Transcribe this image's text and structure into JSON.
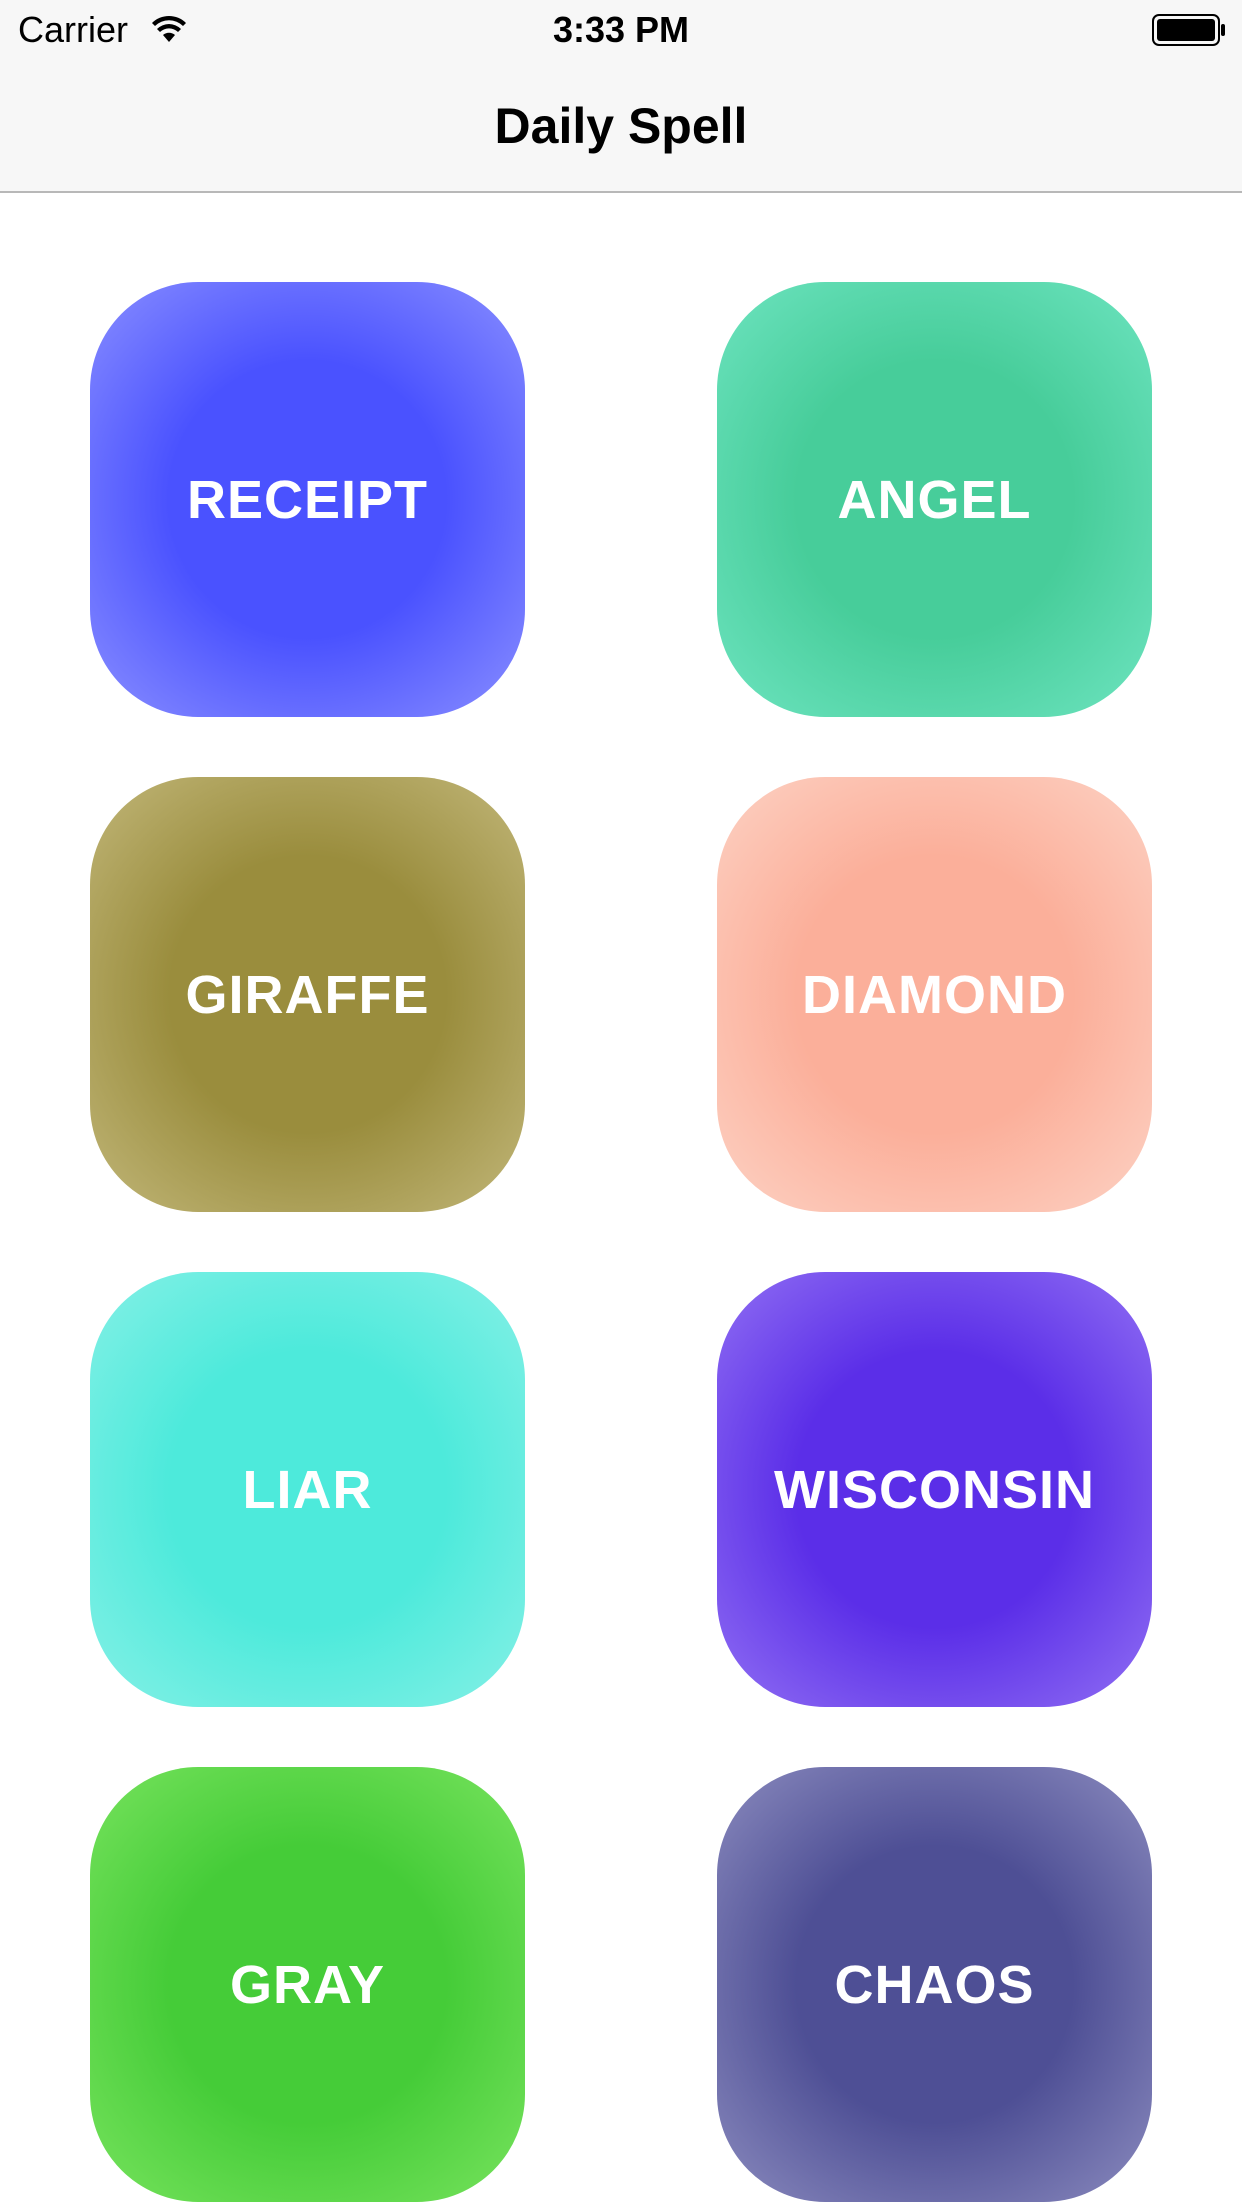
{
  "status_bar": {
    "carrier": "Carrier",
    "time": "3:33 PM",
    "wifi_icon": "wifi-icon",
    "battery_icon": "battery-icon"
  },
  "nav": {
    "title": "Daily Spell"
  },
  "tiles": [
    {
      "label": "RECEIPT",
      "color_center": "#4a52ff",
      "color_edge": "#8a8fff"
    },
    {
      "label": "ANGEL",
      "color_center": "#47cd9a",
      "color_edge": "#6ee4c0"
    },
    {
      "label": "GIRAFFE",
      "color_center": "#9a8d3d",
      "color_edge": "#c2b77a"
    },
    {
      "label": "DIAMOND",
      "color_center": "#fbaf9a",
      "color_edge": "#fdd2c4"
    },
    {
      "label": "LIAR",
      "color_center": "#4deadb",
      "color_edge": "#86f0e6"
    },
    {
      "label": "WISCONSIN",
      "color_center": "#5b2ee8",
      "color_edge": "#9170f3"
    },
    {
      "label": "GRAY",
      "color_center": "#45cc38",
      "color_edge": "#78e35e"
    },
    {
      "label": "CHAOS",
      "color_center": "#4e4f95",
      "color_edge": "#8c8cbf"
    }
  ]
}
